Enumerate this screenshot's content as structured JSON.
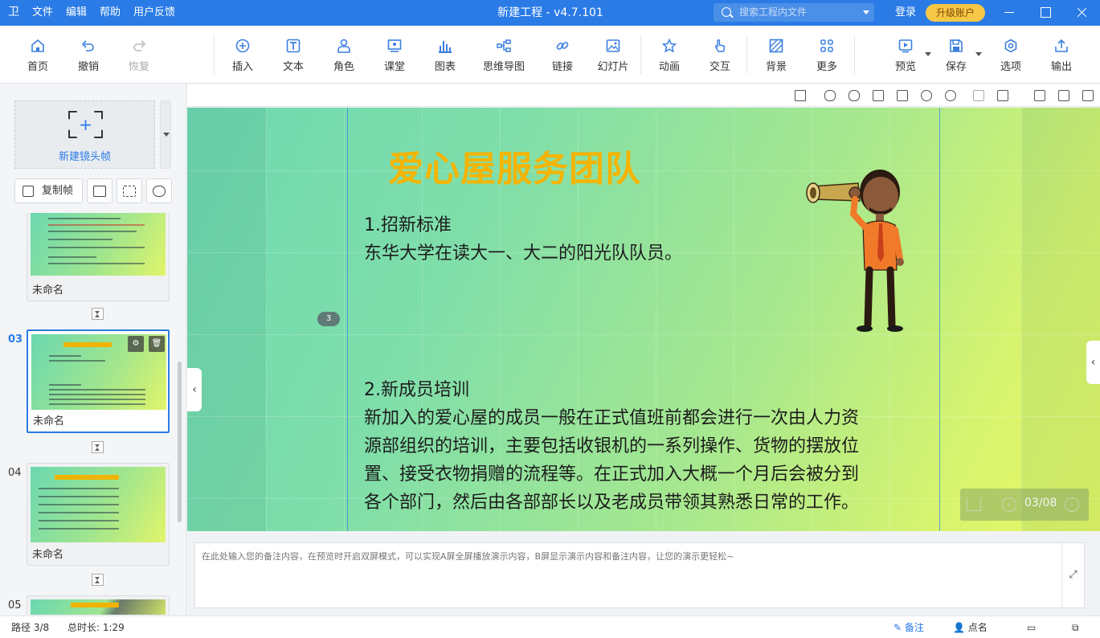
{
  "app": {
    "logo": "卫",
    "menu": [
      "文件",
      "编辑",
      "帮助",
      "用户反馈"
    ],
    "title": "新建工程 - v4.7.101",
    "search_placeholder": "搜索工程内文件",
    "login": "登录",
    "upgrade": "升级账户",
    "accent": "#2a7be6"
  },
  "toolbar": {
    "home": "首页",
    "undo": "撤销",
    "redo": "恢复",
    "insert": "插入",
    "text": "文本",
    "role": "角色",
    "classroom": "课堂",
    "chart": "图表",
    "mindmap": "思维导图",
    "link": "链接",
    "slides": "幻灯片",
    "animation": "动画",
    "interact": "交互",
    "background": "背景",
    "more": "更多",
    "preview": "预览",
    "save": "保存",
    "options": "选项",
    "export": "输出"
  },
  "leftpanel": {
    "new_frame": "新建镜头帧",
    "copy_frame": "复制帧",
    "slides": [
      {
        "num": "",
        "name": "未命名"
      },
      {
        "num": "03",
        "name": "未命名",
        "active": true
      },
      {
        "num": "04",
        "name": "未命名"
      },
      {
        "num": "05",
        "name": ""
      }
    ]
  },
  "slide": {
    "title": "爱心屋服务团队",
    "h1": "1.招新标准",
    "p1": "东华大学在读大一、大二的阳光队队员。",
    "h2": "2.新成员培训",
    "p2_lines": [
      "新加入的爱心屋的成员一般在正式值班前都会进行一次由人力资",
      "源部组织的培训，主要包括收银机的一系列操作、货物的摆放位",
      "置、接受衣物捐赠的流程等。在正式加入大概一个月后会被分到",
      "各个部门，然后由各部部长以及老成员带领其熟悉日常的工作。"
    ],
    "frame_badge": "3",
    "pager": "03/08"
  },
  "notes": {
    "placeholder": "在此处输入您的备注内容，在预览时开启双屏模式，可以实现A屏全屏播放演示内容，B屏显示演示内容和备注内容，让您的演示更轻松~"
  },
  "status": {
    "path": "路径 3/8",
    "duration": "总时长: 1:29",
    "notes_btn": "备注",
    "rollcall_btn": "点名"
  }
}
